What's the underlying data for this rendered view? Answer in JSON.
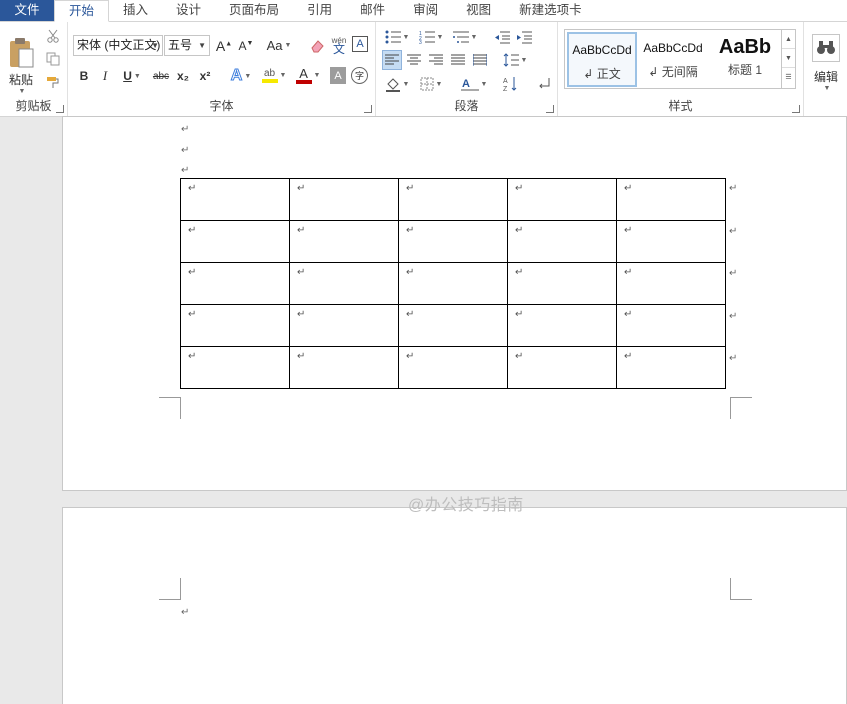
{
  "tabs": [
    {
      "label": "文件",
      "kind": "file"
    },
    {
      "label": "开始",
      "kind": "active"
    },
    {
      "label": "插入",
      "kind": ""
    },
    {
      "label": "设计",
      "kind": ""
    },
    {
      "label": "页面布局",
      "kind": ""
    },
    {
      "label": "引用",
      "kind": ""
    },
    {
      "label": "邮件",
      "kind": ""
    },
    {
      "label": "审阅",
      "kind": ""
    },
    {
      "label": "视图",
      "kind": ""
    },
    {
      "label": "新建选项卡",
      "kind": ""
    }
  ],
  "clipboard": {
    "paste_label": "粘贴",
    "group_label": "剪贴板"
  },
  "font": {
    "name": "宋体 (中文正文)",
    "size": "五号",
    "case_label": "Aa",
    "phonetic_label": "wén",
    "bold": "B",
    "italic": "I",
    "underline": "U",
    "strike": "abc",
    "subscript": "x₂",
    "superscript": "x²",
    "group_label": "字体"
  },
  "paragraph": {
    "group_label": "段落"
  },
  "styles": {
    "group_label": "样式",
    "items": [
      {
        "sample": "AaBbCcDd",
        "name": "正文",
        "selected": true
      },
      {
        "sample": "AaBbCcDd",
        "name": "无间隔",
        "selected": false
      },
      {
        "sample": "AaBb",
        "name": "标题 1",
        "selected": false
      }
    ]
  },
  "editing": {
    "label": "编辑"
  },
  "document": {
    "paragraph_mark": "↵",
    "table": {
      "rows": 5,
      "cols": 5
    }
  },
  "watermark": "@办公技巧指南",
  "colors": {
    "accent": "#2b579a",
    "highlight": "#f6e900",
    "font_color": "#c00000"
  }
}
